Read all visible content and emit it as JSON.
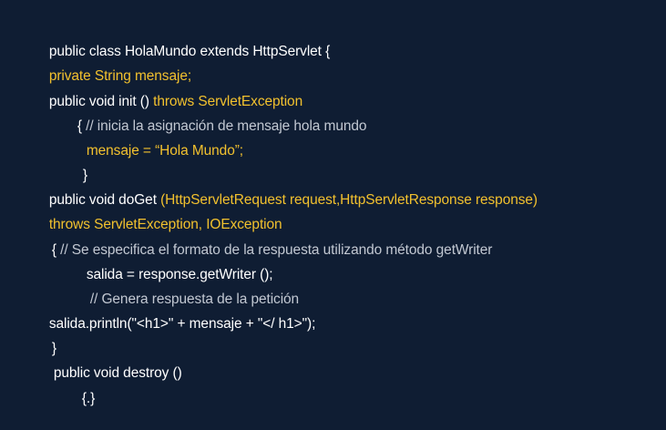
{
  "colors": {
    "background": "#0f1d33",
    "default_text": "#ffffff",
    "highlight_text": "#f2c12e",
    "comment_text": "#c2c8d2"
  },
  "code": {
    "lines": [
      {
        "tokens": [
          {
            "text": "public class HolaMundo extends HttpServlet {",
            "color": "white"
          }
        ]
      },
      {
        "tokens": [
          {
            "text": "private String mensaje;",
            "color": "yellow"
          }
        ]
      },
      {
        "tokens": [
          {
            "text": "public void init () ",
            "color": "white"
          },
          {
            "text": "throws ServletException",
            "color": "yellow"
          }
        ]
      },
      {
        "tokens": [
          {
            "text": "{ ",
            "color": "white"
          },
          {
            "text": "// inicia la asignación de mensaje hola mundo",
            "color": "gray"
          }
        ]
      },
      {
        "tokens": [
          {
            "text": "mensaje = “Hola Mundo”;",
            "color": "yellow"
          }
        ]
      },
      {
        "tokens": [
          {
            "text": "}",
            "color": "white"
          }
        ]
      },
      {
        "tokens": [
          {
            "text": "public void doGet ",
            "color": "white"
          },
          {
            "text": "(HttpServletRequest request,HttpServletResponse response)",
            "color": "yellow"
          }
        ]
      },
      {
        "tokens": [
          {
            "text": "throws ServletException, IOException",
            "color": "yellow"
          }
        ]
      },
      {
        "tokens": [
          {
            "text": "{ ",
            "color": "white"
          },
          {
            "text": "// Se especifica el formato de la respuesta utilizando método getWriter",
            "color": "gray"
          }
        ]
      },
      {
        "tokens": [
          {
            "text": "salida = response.getWriter ();",
            "color": "white"
          }
        ]
      },
      {
        "tokens": [
          {
            "text": "// Genera respuesta de la petición",
            "color": "gray"
          }
        ]
      },
      {
        "tokens": [
          {
            "text": "salida.println(\"<h1>\" + mensaje + \"</ h1>\");",
            "color": "white"
          }
        ]
      },
      {
        "tokens": [
          {
            "text": "}",
            "color": "white"
          }
        ]
      },
      {
        "tokens": [
          {
            "text": "public void destroy ()",
            "color": "white"
          }
        ]
      },
      {
        "tokens": [
          {
            "text": "{.}",
            "color": "white"
          }
        ]
      }
    ]
  }
}
